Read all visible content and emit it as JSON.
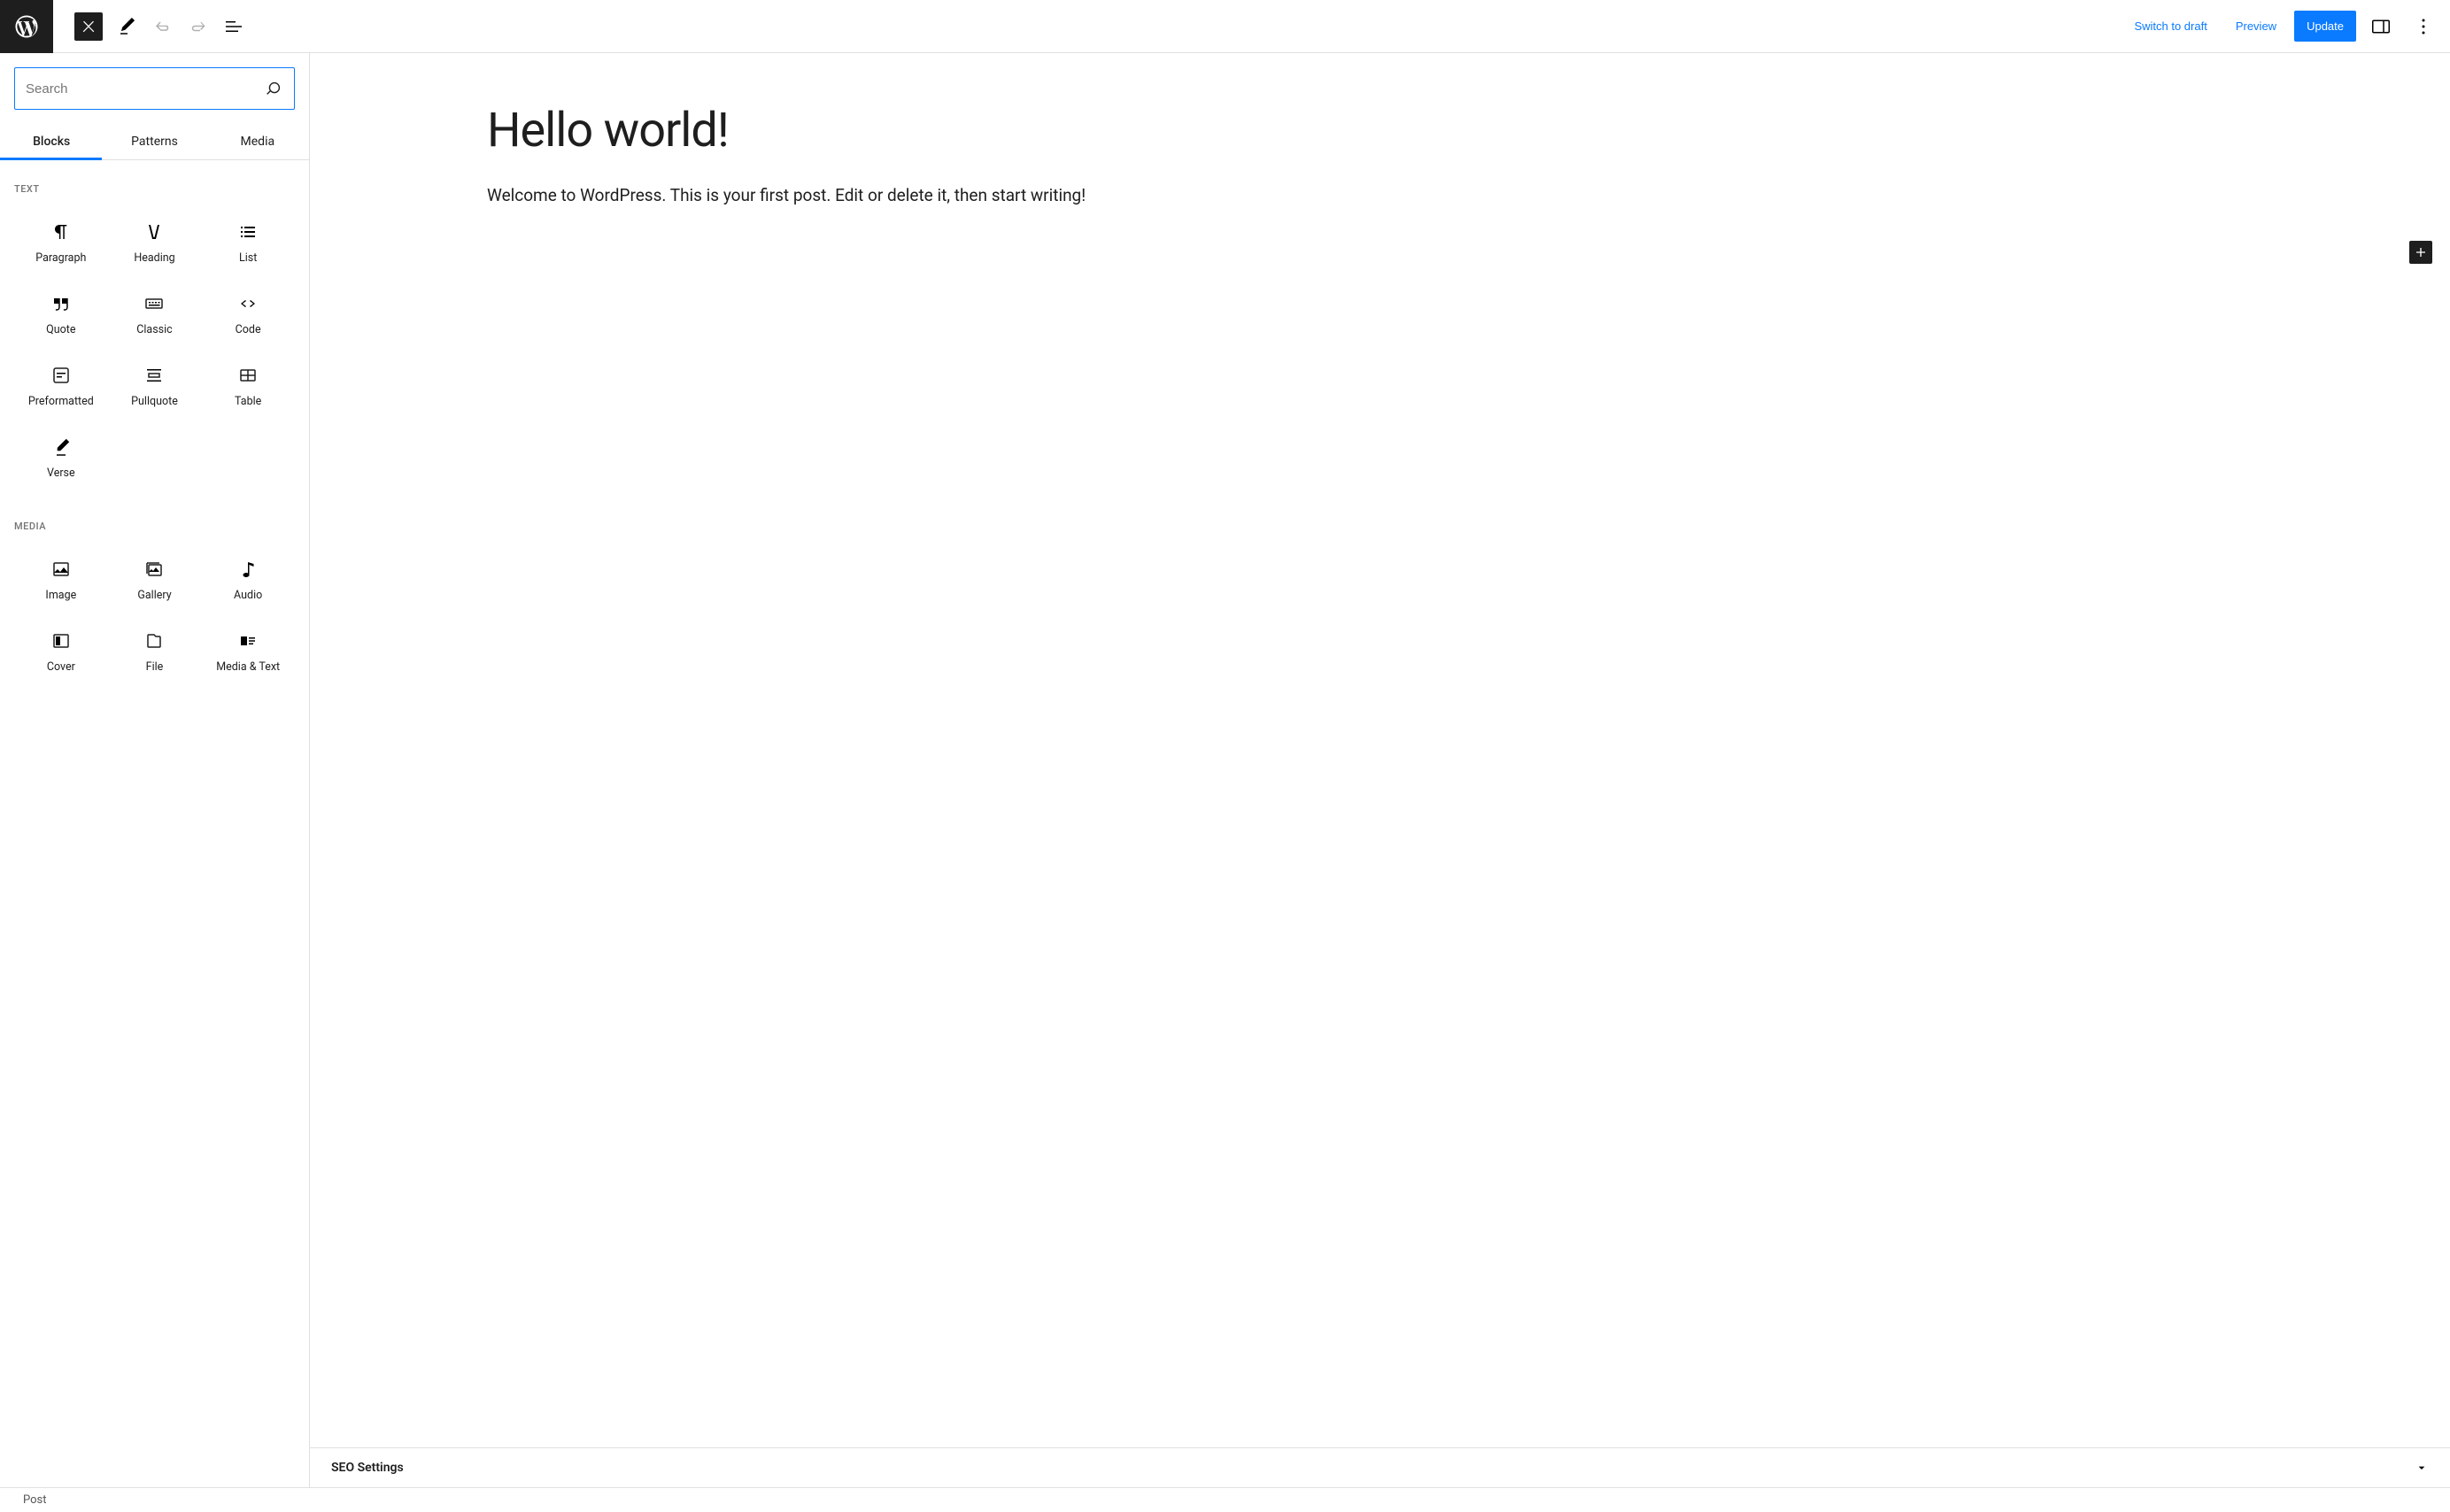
{
  "toolbar": {
    "switch_draft": "Switch to draft",
    "preview": "Preview",
    "update": "Update"
  },
  "inserter": {
    "search_placeholder": "Search",
    "tabs": [
      "Blocks",
      "Patterns",
      "Media"
    ],
    "categories": [
      {
        "label": "Text",
        "blocks": [
          {
            "name": "Paragraph",
            "icon": "paragraph"
          },
          {
            "name": "Heading",
            "icon": "heading"
          },
          {
            "name": "List",
            "icon": "list"
          },
          {
            "name": "Quote",
            "icon": "quote"
          },
          {
            "name": "Classic",
            "icon": "classic"
          },
          {
            "name": "Code",
            "icon": "code"
          },
          {
            "name": "Preformatted",
            "icon": "preformatted"
          },
          {
            "name": "Pullquote",
            "icon": "pullquote"
          },
          {
            "name": "Table",
            "icon": "table"
          },
          {
            "name": "Verse",
            "icon": "verse"
          }
        ]
      },
      {
        "label": "Media",
        "blocks": [
          {
            "name": "Image",
            "icon": "image"
          },
          {
            "name": "Gallery",
            "icon": "gallery"
          },
          {
            "name": "Audio",
            "icon": "audio"
          },
          {
            "name": "Cover",
            "icon": "cover"
          },
          {
            "name": "File",
            "icon": "file"
          },
          {
            "name": "Media & Text",
            "icon": "media-text"
          }
        ]
      }
    ]
  },
  "post": {
    "title": "Hello world!",
    "body": "Welcome to WordPress. This is your first post. Edit or delete it, then start writing!"
  },
  "seo_panel": {
    "title": "SEO Settings"
  },
  "footer": {
    "crumb": "Post"
  }
}
